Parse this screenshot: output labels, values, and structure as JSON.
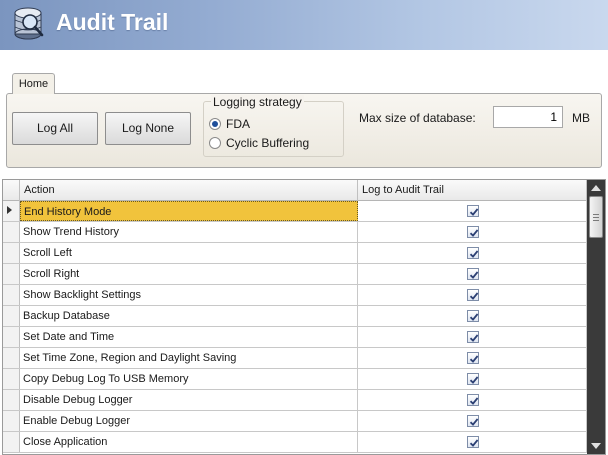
{
  "app": {
    "title": "Audit Trail",
    "icon": "database-icon"
  },
  "ribbon": {
    "tab_label": "Home",
    "log_all_label": "Log All",
    "log_none_label": "Log None",
    "logging_strategy": {
      "title": "Logging strategy",
      "options": [
        "FDA",
        "Cyclic Buffering"
      ],
      "selected": "FDA"
    },
    "max_size_label": "Max size of database:",
    "max_size_value": "1",
    "max_size_unit": "MB"
  },
  "grid": {
    "columns": [
      "Action",
      "Log to Audit Trail"
    ],
    "rows": [
      {
        "action": "End History Mode",
        "logged": true,
        "selected": true
      },
      {
        "action": "Show Trend History",
        "logged": true
      },
      {
        "action": "Scroll Left",
        "logged": true
      },
      {
        "action": "Scroll Right",
        "logged": true
      },
      {
        "action": "Show Backlight Settings",
        "logged": true
      },
      {
        "action": "Backup Database",
        "logged": true
      },
      {
        "action": "Set Date and Time",
        "logged": true
      },
      {
        "action": "Set Time Zone, Region and Daylight Saving",
        "logged": true
      },
      {
        "action": "Copy Debug Log To USB Memory",
        "logged": true
      },
      {
        "action": "Disable Debug Logger",
        "logged": true
      },
      {
        "action": "Enable Debug Logger",
        "logged": true
      },
      {
        "action": "Close Application",
        "logged": true
      }
    ]
  },
  "colors": {
    "banner": "#94acd2",
    "selected_cell": "#f1c33c",
    "scrollbar": "#3a3a3a"
  }
}
